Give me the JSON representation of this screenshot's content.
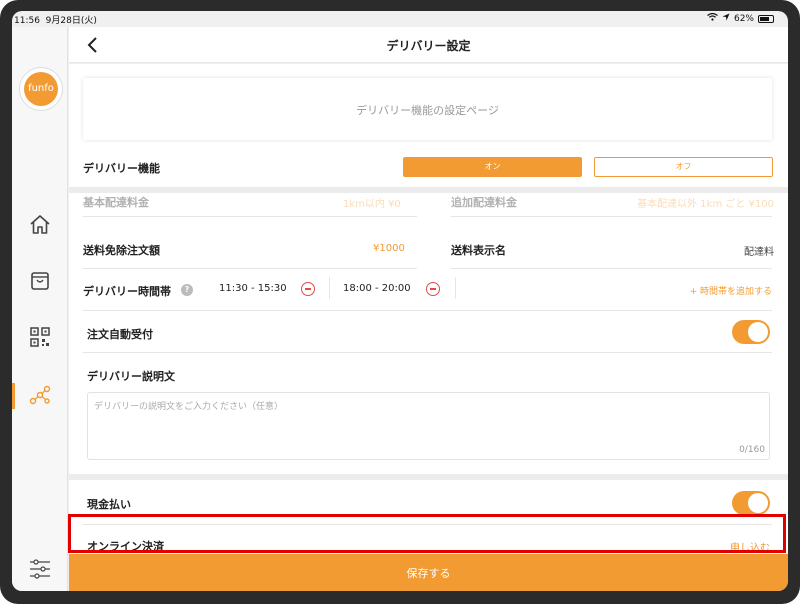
{
  "status_bar": {
    "time": "11:56",
    "date": "9月28日(火)",
    "battery": "62%"
  },
  "sidebar": {
    "logo_text": "funfo",
    "items": [
      {
        "icon": "home-icon"
      },
      {
        "icon": "bag-icon"
      },
      {
        "icon": "qr-code-icon"
      },
      {
        "icon": "share-nodes-icon",
        "active": true
      }
    ],
    "bottom_icon": "sliders-icon"
  },
  "header": {
    "title": "デリバリー設定"
  },
  "banner": {
    "text": "デリバリー機能の設定ページ"
  },
  "delivery_function": {
    "label": "デリバリー機能",
    "on_label": "オン",
    "off_label": "オフ",
    "selected": "on"
  },
  "fees": {
    "base_fee_label": "基本配達料金",
    "base_fee_value": "1km以内 ¥0",
    "extra_fee_label": "追加配達料金",
    "extra_fee_value": "基本配達以外 1km ごと ¥100",
    "free_label": "送料免除注文額",
    "free_value": "¥1000",
    "display_name_label": "送料表示名",
    "display_name_value": "配達料"
  },
  "delivery_time": {
    "label": "デリバリー時間帯",
    "slots": [
      "11:30 - 15:30",
      "18:00 - 20:00"
    ],
    "add_label": "+ 時間帯を追加する"
  },
  "auto_accept": {
    "label": "注文自動受付",
    "enabled": true
  },
  "description": {
    "label": "デリバリー説明文",
    "placeholder": "デリバリーの説明文をご入力ください（任意）",
    "counter": "0/160"
  },
  "cash": {
    "label": "現金払い",
    "enabled": true
  },
  "online_payment": {
    "label": "オンライン決済",
    "action": "申し込む"
  },
  "save": {
    "label": "保存する"
  },
  "colors": {
    "accent": "#f29b33",
    "highlight": "#e00000"
  }
}
